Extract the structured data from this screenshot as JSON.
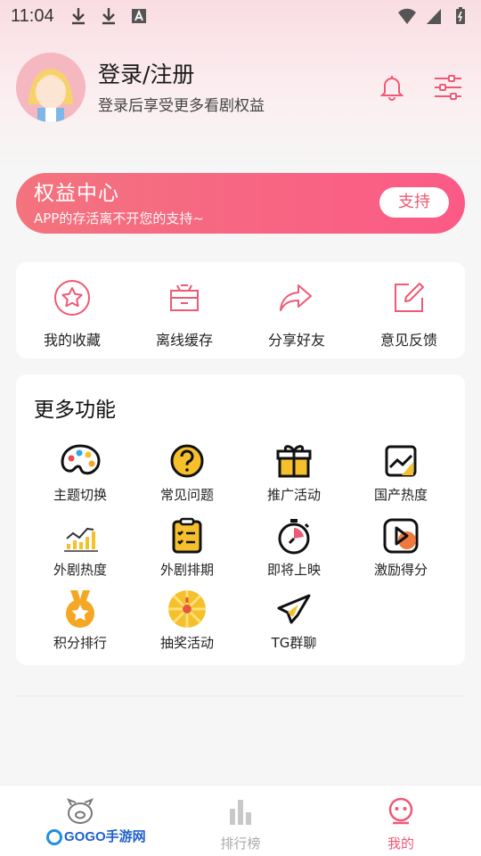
{
  "status_bar": {
    "time": "11:04"
  },
  "header": {
    "title": "登录/注册",
    "subtitle": "登录后享受更多看剧权益"
  },
  "banner": {
    "title": "权益中心",
    "subtitle": "APP的存活离不开您的支持~",
    "button": "支持"
  },
  "quick_actions": [
    {
      "label": "我的收藏"
    },
    {
      "label": "离线缓存"
    },
    {
      "label": "分享好友"
    },
    {
      "label": "意见反馈"
    }
  ],
  "more": {
    "title": "更多功能",
    "items": [
      {
        "label": "主题切换"
      },
      {
        "label": "常见问题"
      },
      {
        "label": "推广活动"
      },
      {
        "label": "国产热度"
      },
      {
        "label": "外剧热度"
      },
      {
        "label": "外剧排期"
      },
      {
        "label": "即将上映"
      },
      {
        "label": "激励得分"
      },
      {
        "label": "积分排行"
      },
      {
        "label": "抽奖活动"
      },
      {
        "label": "TG群聊"
      }
    ]
  },
  "bottom_nav": {
    "items": [
      {
        "label": ""
      },
      {
        "label": "排行榜"
      },
      {
        "label": "我的"
      }
    ],
    "watermark": "GOGO手游网"
  },
  "colors": {
    "accent": "#ef5975",
    "banner_start": "#f3737e",
    "banner_end": "#fb5a86"
  }
}
